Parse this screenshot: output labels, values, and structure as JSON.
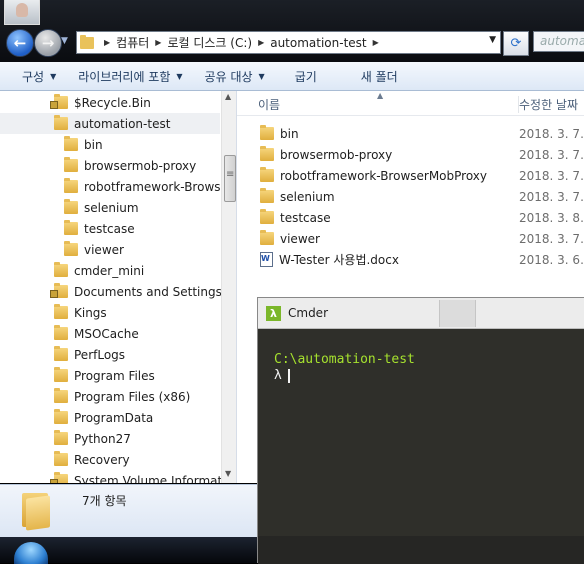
{
  "address_bar": {
    "crumbs": [
      "컴퓨터",
      "로컬 디스크 (C:)",
      "automation-test"
    ],
    "search_placeholder": "automati"
  },
  "toolbar": {
    "items": [
      "구성",
      "라이브러리에 포함",
      "공유 대상",
      "굽기",
      "새 폴더"
    ]
  },
  "nav_tree": {
    "items": [
      {
        "label": "$Recycle.Bin",
        "level": 0,
        "locked": true
      },
      {
        "label": "automation-test",
        "level": 0,
        "selected": true
      },
      {
        "label": "bin",
        "level": 1
      },
      {
        "label": "browsermob-proxy",
        "level": 1
      },
      {
        "label": "robotframework-BrowserMobProxy",
        "level": 1
      },
      {
        "label": "selenium",
        "level": 1
      },
      {
        "label": "testcase",
        "level": 1
      },
      {
        "label": "viewer",
        "level": 1
      },
      {
        "label": "cmder_mini",
        "level": 0
      },
      {
        "label": "Documents and Settings",
        "level": 0,
        "locked": true
      },
      {
        "label": "Kings",
        "level": 0
      },
      {
        "label": "MSOCache",
        "level": 0
      },
      {
        "label": "PerfLogs",
        "level": 0
      },
      {
        "label": "Program Files",
        "level": 0
      },
      {
        "label": "Program Files (x86)",
        "level": 0
      },
      {
        "label": "ProgramData",
        "level": 0
      },
      {
        "label": "Python27",
        "level": 0
      },
      {
        "label": "Recovery",
        "level": 0
      },
      {
        "label": "System Volume Information",
        "level": 0,
        "locked": true
      }
    ]
  },
  "file_list": {
    "col_name": "이름",
    "col_date": "수정한 날짜",
    "rows": [
      {
        "name": "bin",
        "date": "2018. 3. 7. ...",
        "type": "folder"
      },
      {
        "name": "browsermob-proxy",
        "date": "2018. 3. 7. ...",
        "type": "folder"
      },
      {
        "name": "robotframework-BrowserMobProxy",
        "date": "2018. 3. 7. ...",
        "type": "folder"
      },
      {
        "name": "selenium",
        "date": "2018. 3. 7. ...",
        "type": "folder"
      },
      {
        "name": "testcase",
        "date": "2018. 3. 8. ...",
        "type": "folder"
      },
      {
        "name": "viewer",
        "date": "2018. 3. 7. ...",
        "type": "folder"
      },
      {
        "name": "W-Tester 사용법.docx",
        "date": "2018. 3. 6. ...",
        "type": "word-doc"
      }
    ]
  },
  "status_bar": {
    "item_count": "7개 항목"
  },
  "cmder": {
    "logo": "λ",
    "title": "Cmder",
    "path": "C:\\automation-test",
    "prompt": "λ"
  }
}
